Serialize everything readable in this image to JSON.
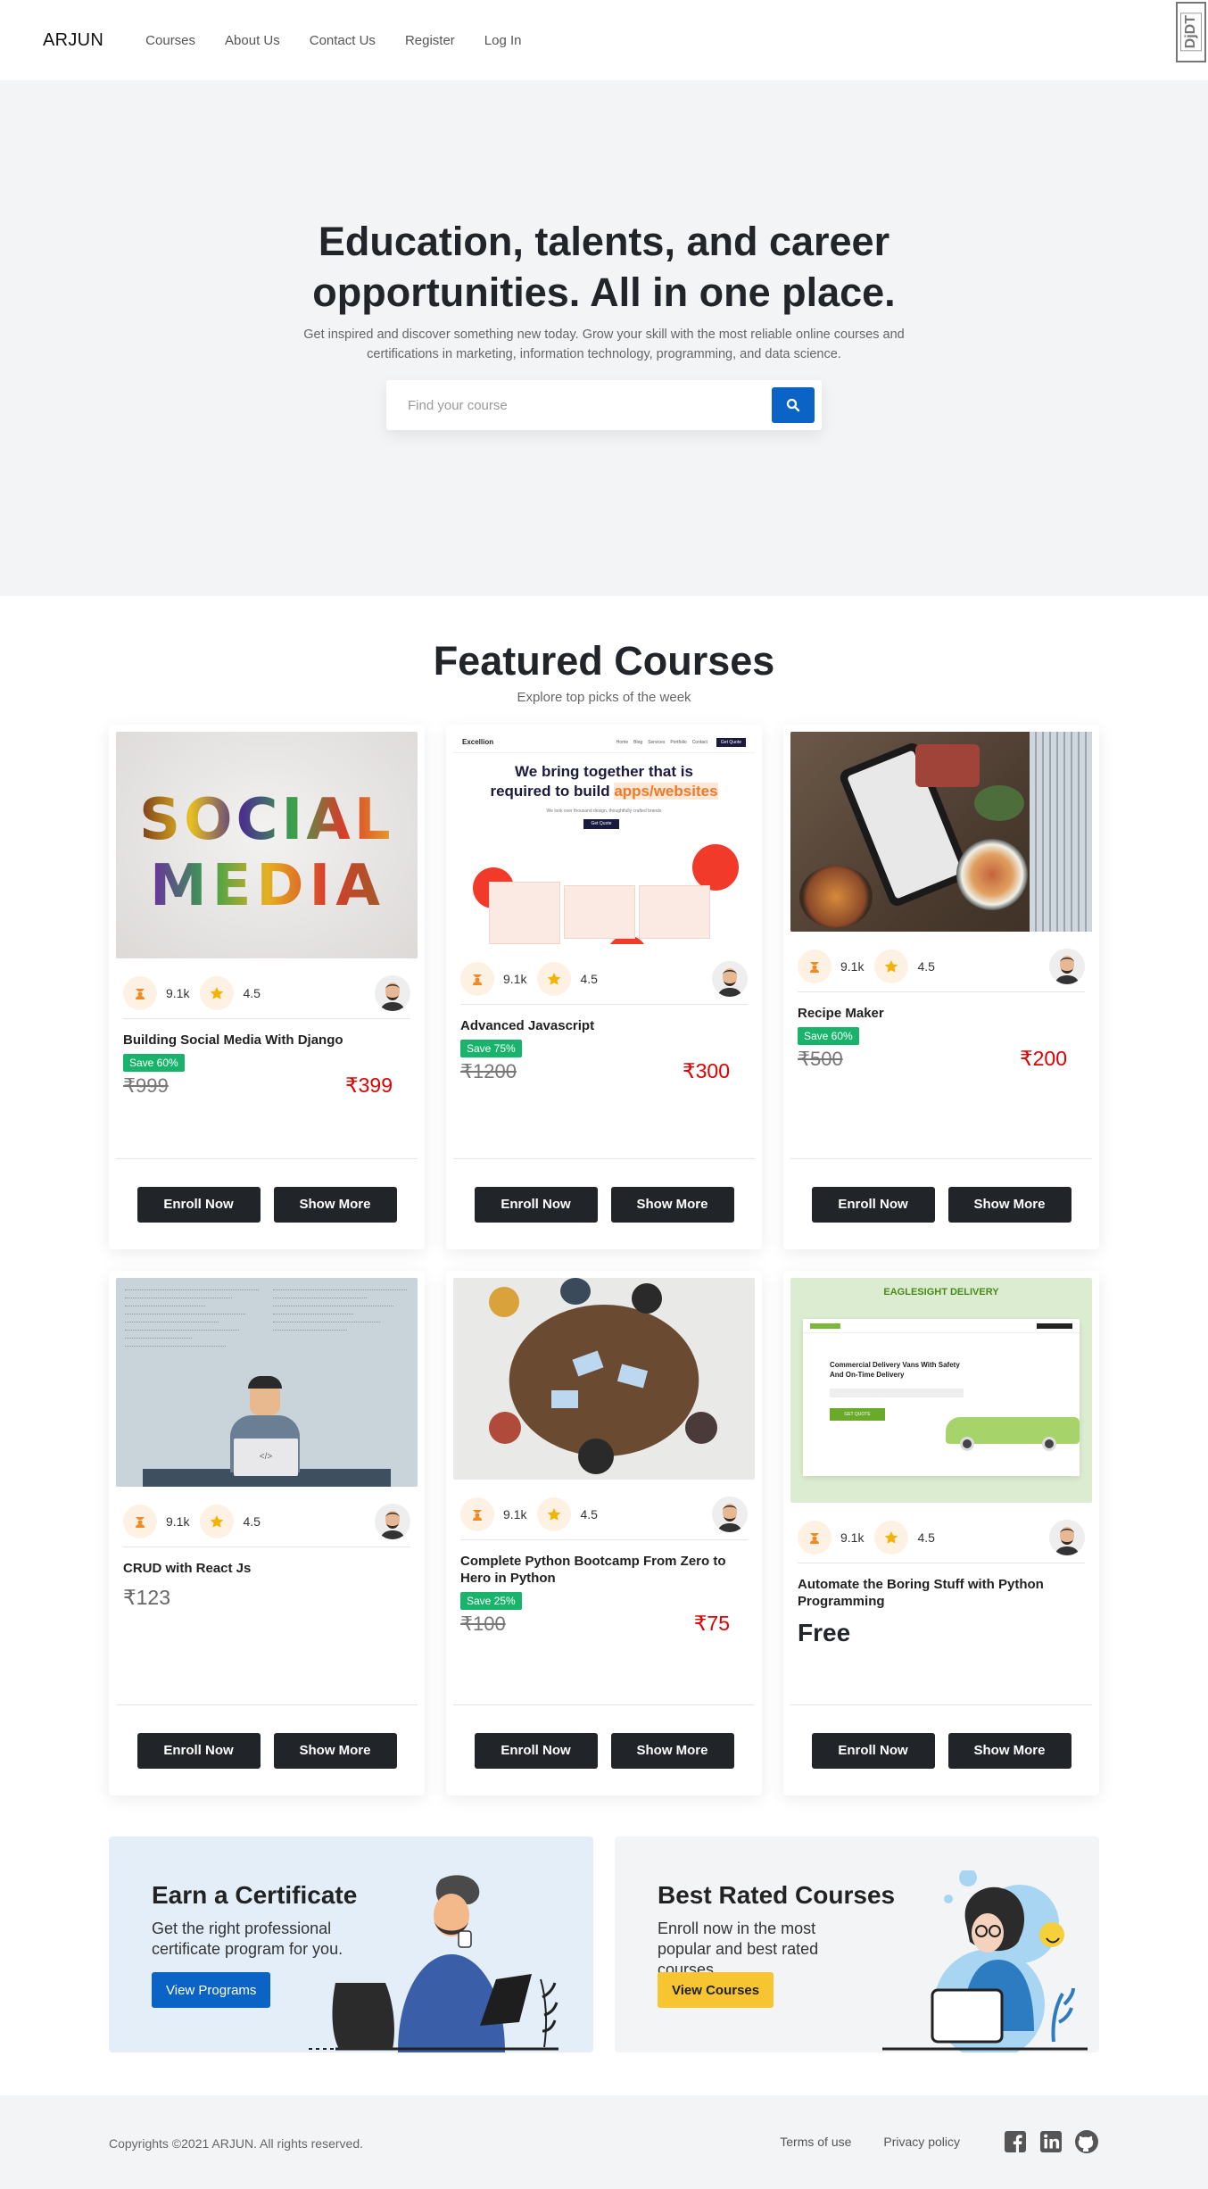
{
  "nav": {
    "brand": "ARJUN",
    "links": [
      "Courses",
      "About Us",
      "Contact Us",
      "Register",
      "Log In"
    ],
    "debug_badge": "DjDT"
  },
  "hero": {
    "title": "Education, talents, and career opportunities. All in one place.",
    "subtitle": "Get inspired and discover something new today. Grow your skill with the most reliable online courses and certifications in marketing, information technology, programming, and data science.",
    "search_placeholder": "Find your course",
    "search_icon": "search-icon",
    "accent": "#0b63c5"
  },
  "featured": {
    "title": "Featured Courses",
    "subtitle": "Explore top picks of the week"
  },
  "courses": [
    {
      "title": "Building Social Media With Django",
      "students": "9.1k",
      "rating": "4.5",
      "save": "Save 60%",
      "old_price": "₹999",
      "price": "₹399",
      "thumb_text_1": "SOCIAL",
      "thumb_text_2": "MEDIA"
    },
    {
      "title": "Advanced Javascript",
      "students": "9.1k",
      "rating": "4.5",
      "save": "Save 75%",
      "old_price": "₹1200",
      "price": "₹300",
      "thumb_brand": "Excellion",
      "thumb_nav": [
        "Home",
        "Blog",
        "Services",
        "Portfolio",
        "Contact"
      ],
      "thumb_cta": "Get Quote",
      "thumb_headline_1": "We bring together that is",
      "thumb_headline_2": "required to build",
      "thumb_highlight": "apps/websites",
      "thumb_sub": "We look over thousand design, thoughtfully crafted brands",
      "thumb_btn": "Get Quote"
    },
    {
      "title": "Recipe Maker",
      "students": "9.1k",
      "rating": "4.5",
      "save": "Save 60%",
      "old_price": "₹500",
      "price": "₹200"
    },
    {
      "title": "CRUD with React Js",
      "students": "9.1k",
      "rating": "4.5",
      "price": "₹123",
      "thumb_code": "</>"
    },
    {
      "title": "Complete Python Bootcamp From Zero to Hero in Python",
      "students": "9.1k",
      "rating": "4.5",
      "save": "Save 25%",
      "old_price": "₹100",
      "price": "₹75"
    },
    {
      "title": "Automate the Boring Stuff with Python Programming",
      "students": "9.1k",
      "rating": "4.5",
      "price": "Free",
      "thumb_brand": "EAGLESIGHT DELIVERY",
      "thumb_headline": "Commercial Delivery Vans With Safety And On-Time Delivery",
      "thumb_btn": "GET QUOTE"
    }
  ],
  "buttons": {
    "enroll": "Enroll Now",
    "more": "Show More"
  },
  "promos": {
    "certificate": {
      "title": "Earn a Certificate",
      "text": "Get the right professional certificate program for you.",
      "button": "View Programs",
      "bg": "#e4eef9",
      "button_color": "#0b63c5"
    },
    "best": {
      "title": "Best Rated Courses",
      "text": "Enroll now in the most popular and best rated courses.",
      "button": "View Courses",
      "bg": "#f3f4f6",
      "button_color": "#f7c531"
    }
  },
  "footer": {
    "copyright": "Copyrights ©2021 ARJUN. All rights reserved.",
    "links": [
      "Terms of use",
      "Privacy policy"
    ],
    "social_icons": [
      "facebook-icon",
      "linkedin-icon",
      "github-icon"
    ]
  }
}
